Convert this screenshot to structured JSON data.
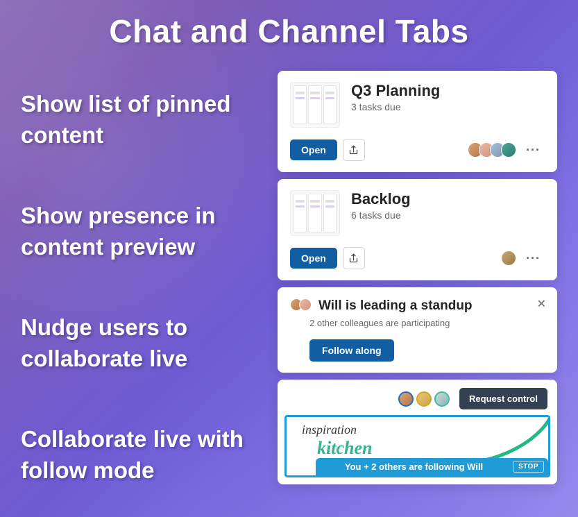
{
  "title": "Chat and Channel Tabs",
  "bullets": [
    "Show list of pinned content",
    "Show presence in content preview",
    "Nudge users to collaborate live",
    "Collaborate live with follow mode"
  ],
  "cards": {
    "planning": {
      "title": "Q3 Planning",
      "subtitle": "3 tasks due",
      "open_label": "Open"
    },
    "backlog": {
      "title": "Backlog",
      "subtitle": "6 tasks due",
      "open_label": "Open"
    }
  },
  "standup": {
    "title": "Will is leading a standup",
    "subtitle": "2 other colleagues are participating",
    "button_label": "Follow along"
  },
  "whiteboard": {
    "request_label": "Request control",
    "text1": "inspiration",
    "text2": "kitchen",
    "follow_text": "You + 2 others are following Will",
    "stop_label": "STOP"
  }
}
